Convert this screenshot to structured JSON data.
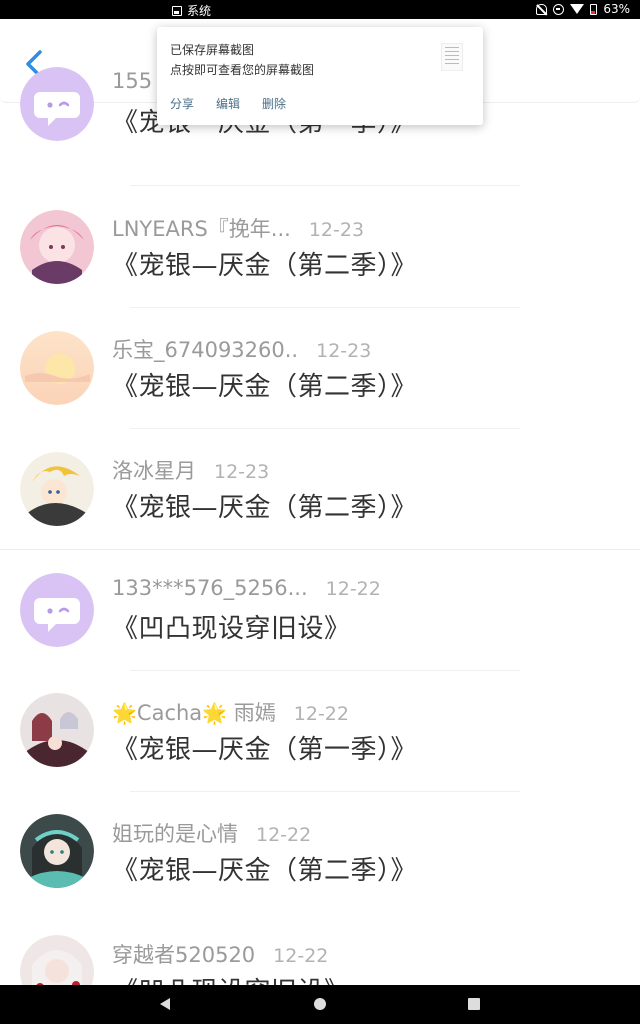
{
  "status_bar": {
    "app_label": "系统",
    "battery": "63%"
  },
  "notification": {
    "title": "已保存屏幕截图",
    "subtitle": "点按即可查看您的屏幕截图",
    "share": "分享",
    "edit": "编辑",
    "delete": "删除"
  },
  "list": [
    {
      "name": "155",
      "date": "",
      "title": "《宠银—厌金（第一季）》",
      "avatar": "default-chat"
    },
    {
      "name": "LNYEARS『挽年...",
      "date": "12-23",
      "title": "《宠银—厌金（第二季）》",
      "avatar": "pink-hair"
    },
    {
      "name": "乐宝_674093260..",
      "date": "12-23",
      "title": "《宠银—厌金（第二季）》",
      "avatar": "sunset"
    },
    {
      "name": "洛冰星月",
      "date": "12-23",
      "title": "《宠银—厌金（第二季）》",
      "avatar": "blond-anime"
    },
    {
      "name": "133***576_5256...",
      "date": "12-22",
      "title": "《凹凸现设穿旧设》",
      "avatar": "default-chat"
    },
    {
      "name_prefix": "Cacha",
      "name_suffix": "雨嫣",
      "date": "12-22",
      "title": "《宠银—厌金（第一季）》",
      "avatar": "group-anime"
    },
    {
      "name": "姐玩的是心情",
      "date": "12-22",
      "title": "《宠银—厌金（第二季）》",
      "avatar": "teal-anime"
    },
    {
      "name": "穿越者520520",
      "date": "12-22",
      "title": "《凹凸现设穿旧设》",
      "avatar": "red-anime"
    }
  ],
  "colors": {
    "accent": "#2f8de4",
    "default_avatar": "#d9c3f5",
    "name_gray": "#9a9a9a"
  }
}
